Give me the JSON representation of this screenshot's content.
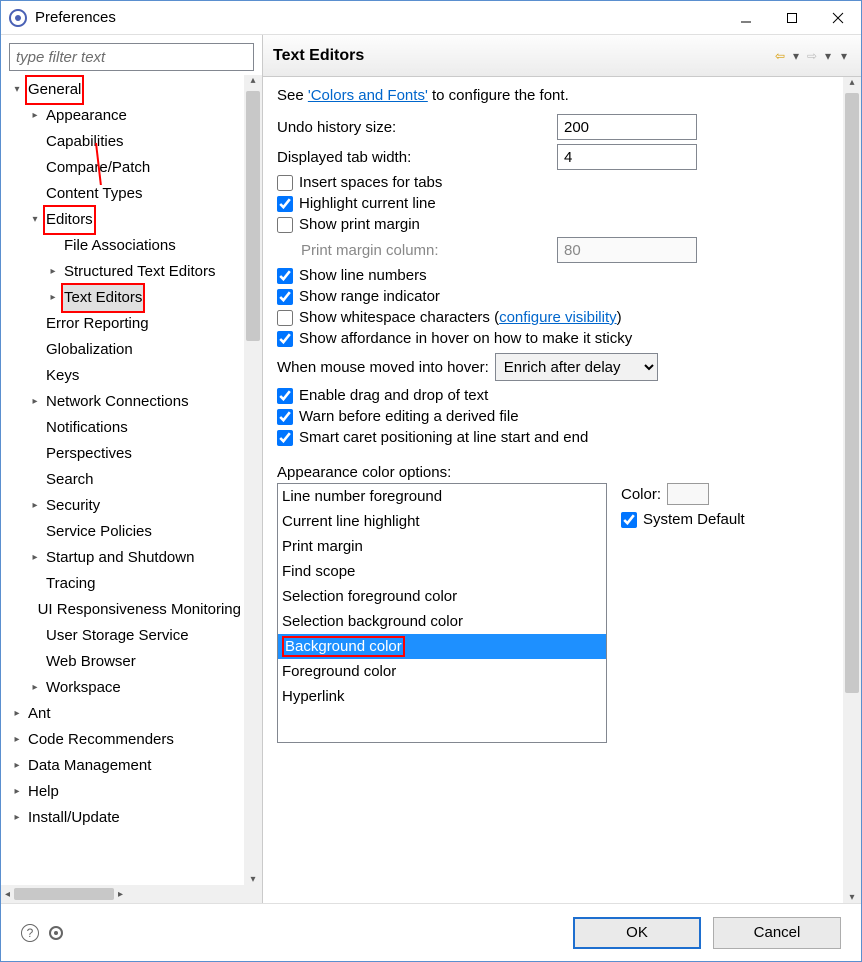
{
  "window": {
    "title": "Preferences"
  },
  "filter": {
    "placeholder": "type filter text"
  },
  "tree": {
    "items": [
      {
        "ind": 0,
        "tw": "▾",
        "label": "General",
        "boxed": true
      },
      {
        "ind": 1,
        "tw": "▸",
        "label": "Appearance"
      },
      {
        "ind": 1,
        "tw": "",
        "label": "Capabilities"
      },
      {
        "ind": 1,
        "tw": "",
        "label": "Compare/Patch"
      },
      {
        "ind": 1,
        "tw": "",
        "label": "Content Types"
      },
      {
        "ind": 1,
        "tw": "▾",
        "label": "Editors",
        "boxed": true
      },
      {
        "ind": 2,
        "tw": "",
        "label": "File Associations"
      },
      {
        "ind": 2,
        "tw": "▸",
        "label": "Structured Text Editors"
      },
      {
        "ind": 2,
        "tw": "▸",
        "label": "Text Editors",
        "sel": true,
        "boxed": true
      },
      {
        "ind": 1,
        "tw": "",
        "label": "Error Reporting"
      },
      {
        "ind": 1,
        "tw": "",
        "label": "Globalization"
      },
      {
        "ind": 1,
        "tw": "",
        "label": "Keys"
      },
      {
        "ind": 1,
        "tw": "▸",
        "label": "Network Connections"
      },
      {
        "ind": 1,
        "tw": "",
        "label": "Notifications"
      },
      {
        "ind": 1,
        "tw": "",
        "label": "Perspectives"
      },
      {
        "ind": 1,
        "tw": "",
        "label": "Search"
      },
      {
        "ind": 1,
        "tw": "▸",
        "label": "Security"
      },
      {
        "ind": 1,
        "tw": "",
        "label": "Service Policies"
      },
      {
        "ind": 1,
        "tw": "▸",
        "label": "Startup and Shutdown"
      },
      {
        "ind": 1,
        "tw": "",
        "label": "Tracing"
      },
      {
        "ind": 1,
        "tw": "",
        "label": "UI Responsiveness Monitoring"
      },
      {
        "ind": 1,
        "tw": "",
        "label": "User Storage Service"
      },
      {
        "ind": 1,
        "tw": "",
        "label": "Web Browser"
      },
      {
        "ind": 1,
        "tw": "▸",
        "label": "Workspace"
      },
      {
        "ind": 0,
        "tw": "▸",
        "label": "Ant"
      },
      {
        "ind": 0,
        "tw": "▸",
        "label": "Code Recommenders"
      },
      {
        "ind": 0,
        "tw": "▸",
        "label": "Data Management"
      },
      {
        "ind": 0,
        "tw": "▸",
        "label": "Help"
      },
      {
        "ind": 0,
        "tw": "▸",
        "label": "Install/Update"
      }
    ]
  },
  "pane": {
    "title": "Text Editors",
    "see_pre": "See ",
    "see_link": "'Colors and Fonts'",
    "see_post": " to configure the font.",
    "undo_label": "Undo history size:",
    "undo_value": "200",
    "tab_label": "Displayed tab width:",
    "tab_value": "4",
    "chk_spaces": "Insert spaces for tabs",
    "chk_highlight": "Highlight current line",
    "chk_printmargin": "Show print margin",
    "printcol_label": "Print margin column:",
    "printcol_value": "80",
    "chk_linenum": "Show line numbers",
    "chk_range": "Show range indicator",
    "chk_ws_pre": "Show whitespace characters (",
    "chk_ws_link": "configure visibility",
    "chk_ws_post": ")",
    "chk_afford": "Show affordance in hover on how to make it sticky",
    "hover_label": "When mouse moved into hover:",
    "hover_value": "Enrich after delay",
    "chk_dnd": "Enable drag and drop of text",
    "chk_warn": "Warn before editing a derived file",
    "chk_caret": "Smart caret positioning at line start and end",
    "appearance_label": "Appearance color options:",
    "color_options": [
      "Line number foreground",
      "Current line highlight",
      "Print margin",
      "Find scope",
      "Selection foreground color",
      "Selection background color",
      "Background color",
      "Foreground color",
      "Hyperlink"
    ],
    "color_selected_index": 6,
    "color_label": "Color:",
    "sysdefault_label": "System Default"
  },
  "footer": {
    "ok": "OK",
    "cancel": "Cancel"
  }
}
